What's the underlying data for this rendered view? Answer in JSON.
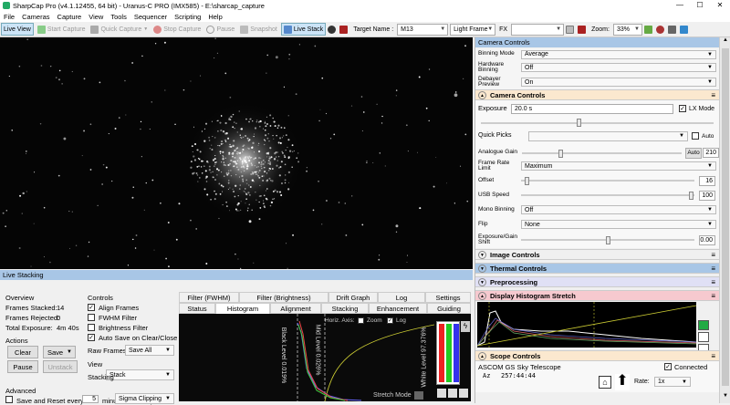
{
  "window": {
    "title": "SharpCap Pro (v4.1.12455, 64 bit) - Uranus-C PRO (IMX585) - E:\\sharcap_capture",
    "min": "—",
    "max": "☐",
    "close": "✕"
  },
  "menu": [
    "File",
    "Cameras",
    "Capture",
    "View",
    "Tools",
    "Sequencer",
    "Scripting",
    "Help"
  ],
  "toolbar": {
    "live_view": "Live View",
    "start_capture": "Start Capture",
    "quick_capture": "Quick Capture",
    "stop_capture": "Stop Capture",
    "pause": "Pause",
    "snapshot": "Snapshot",
    "live_stack": "Live Stack",
    "target_label": "Target Name :",
    "target_value": "M13",
    "frame_type": "Light Frame",
    "fx_label": "FX",
    "zoom_label": "Zoom:",
    "zoom_value": "33%"
  },
  "camera_controls": {
    "header": "Camera Controls",
    "binning_mode_label": "Binning Mode",
    "binning_mode_value": "Average",
    "hw_binning_label": "Hardware Binning",
    "hw_binning_value": "Off",
    "debayer_label": "Debayer Preview",
    "debayer_value": "On",
    "section_title": "Camera Controls",
    "exposure_label": "Exposure",
    "exposure_value": "20.0 s",
    "lx_mode_label": "LX Mode",
    "quick_picks_label": "Quick Picks",
    "auto_label": "Auto",
    "analogue_gain_label": "Analogue Gain",
    "analogue_gain_auto": "Auto",
    "analogue_gain_value": "210",
    "frame_rate_label": "Frame Rate Limit",
    "frame_rate_value": "Maximum",
    "offset_label": "Offset",
    "offset_value": "16",
    "usb_speed_label": "USB Speed",
    "usb_speed_value": "100",
    "mono_binning_label": "Mono Binning",
    "mono_binning_value": "Off",
    "flip_label": "Flip",
    "flip_value": "None",
    "exp_gain_shift_label": "Exposure/Gain Shift",
    "exp_gain_shift_value": "0.00"
  },
  "sections": {
    "image_controls": "Image Controls",
    "thermal_controls": "Thermal Controls",
    "preprocessing": "Preprocessing",
    "display_histogram": "Display Histogram Stretch",
    "scope_controls": "Scope Controls"
  },
  "scope": {
    "name": "ASCOM GS Sky Telescope",
    "connected_label": "Connected",
    "az_label": "Az",
    "az_value": "257:44:44",
    "rate_label": "Rate:",
    "rate_value": "1x"
  },
  "live_stacking": {
    "header": "Live Stacking",
    "overview_label": "Overview",
    "frames_stacked_label": "Frames Stacked:",
    "frames_stacked_value": "14",
    "frames_rejected_label": "Frames Rejected:",
    "frames_rejected_value": "0",
    "total_exposure_label": "Total Exposure:",
    "total_exposure_value": "4m 40s",
    "actions_label": "Actions",
    "clear_btn": "Clear",
    "save_btn": "Save",
    "pause_btn": "Pause",
    "unstack_btn": "Unstack",
    "advanced_label": "Advanced",
    "save_reset_label": "Save and Reset every",
    "save_reset_value": "5",
    "save_reset_suffix": "minutes total exposure",
    "controls_label": "Controls",
    "align_frames": "Align Frames",
    "fwhm_filter": "FWHM Filter",
    "brightness_filter": "Brightness Filter",
    "auto_save": "Auto Save on Clear/Close",
    "raw_frames_label": "Raw Frames",
    "raw_frames_value": "Save All",
    "view_label": "View",
    "view_value": "Stack",
    "stacking_label": "Stacking",
    "stacking_value": "Sigma Clipping",
    "tabs_row1": [
      "Filter (FWHM)",
      "Filter (Brightness)",
      "Drift Graph",
      "Log",
      "Settings"
    ],
    "tabs_row2": [
      "Status",
      "Histogram",
      "Alignment",
      "Stacking",
      "Enhancement",
      "Guiding"
    ],
    "hist_horiz_axis": "Horiz. Axis:",
    "hist_zoom": "Zoom",
    "hist_log": "Log",
    "hist_black_level": "Black Level 0.019%",
    "hist_mid_level": "Mid Level 0.026%",
    "hist_white_level": "White Level 97.376%",
    "stretch_mode": "Stretch Mode"
  }
}
